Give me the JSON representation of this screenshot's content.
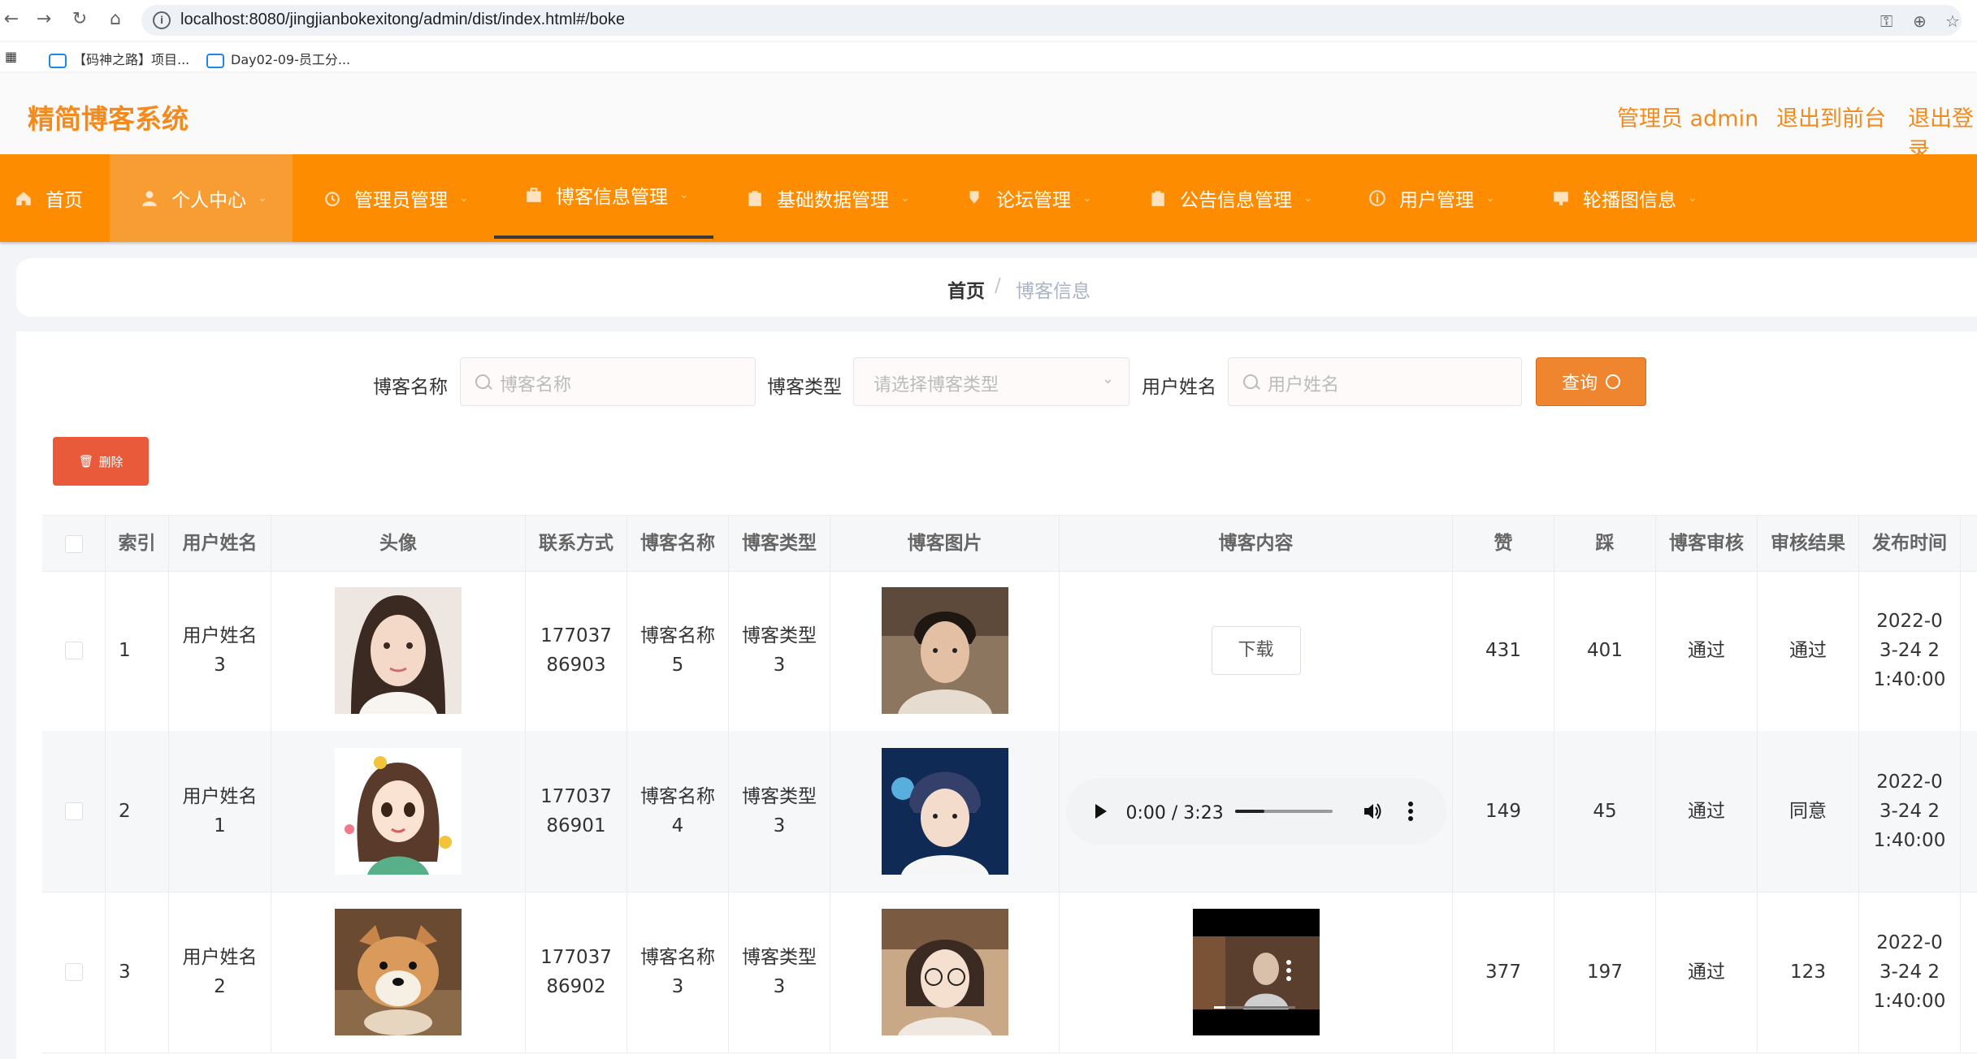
{
  "browser": {
    "url": "localhost:8080/jingjianbokexitong/admin/dist/index.html#/boke",
    "bookmarks": [
      "【码神之路】项目...",
      "Day02-09-员工分..."
    ]
  },
  "header": {
    "title": "精简博客系统",
    "admin_label": "管理员 admin",
    "exit_front": "退出到前台",
    "logout": "退出登录"
  },
  "menu": [
    {
      "label": "首页",
      "icon": "home-icon"
    },
    {
      "label": "个人中心",
      "icon": "user-icon"
    },
    {
      "label": "管理员管理",
      "icon": "alarm-icon"
    },
    {
      "label": "博客信息管理",
      "icon": "briefcase-icon"
    },
    {
      "label": "基础数据管理",
      "icon": "clipboard-icon"
    },
    {
      "label": "论坛管理",
      "icon": "pin-icon"
    },
    {
      "label": "公告信息管理",
      "icon": "clipboard-icon"
    },
    {
      "label": "用户管理",
      "icon": "info-icon"
    },
    {
      "label": "轮播图信息",
      "icon": "monitor-icon"
    }
  ],
  "breadcrumb": {
    "home": "首页",
    "sep": "/",
    "current": "博客信息"
  },
  "search": {
    "name_label": "博客名称",
    "name_placeholder": "博客名称",
    "type_label": "博客类型",
    "type_placeholder": "请选择博客类型",
    "user_label": "用户姓名",
    "user_placeholder": "用户姓名",
    "query_button": "查询"
  },
  "actions": {
    "delete_button": "删除"
  },
  "table": {
    "headers": [
      "索引",
      "用户姓名",
      "头像",
      "联系方式",
      "博客名称",
      "博客类型",
      "博客图片",
      "博客内容",
      "赞",
      "踩",
      "博客审核",
      "审核结果",
      "发布时间"
    ],
    "rows": [
      {
        "index": "1",
        "user": "用户姓名3",
        "phone": "17703786903",
        "blog_name": "博客名称5",
        "blog_type": "博客类型3",
        "content_type": "download",
        "content_label": "下载",
        "likes": "431",
        "dislikes": "401",
        "review": "通过",
        "result": "通过",
        "time": "2022-03-24 21:40:00"
      },
      {
        "index": "2",
        "user": "用户姓名1",
        "phone": "17703786901",
        "blog_name": "博客名称4",
        "blog_type": "博客类型3",
        "content_type": "audio",
        "audio_time": "0:00 / 3:23",
        "likes": "149",
        "dislikes": "45",
        "review": "通过",
        "result": "同意",
        "time": "2022-03-24 21:40:00"
      },
      {
        "index": "3",
        "user": "用户姓名2",
        "phone": "17703786902",
        "blog_name": "博客名称3",
        "blog_type": "博客类型3",
        "content_type": "video",
        "likes": "377",
        "dislikes": "197",
        "review": "通过",
        "result": "123",
        "time": "2022-03-24 21:40:00"
      }
    ]
  }
}
